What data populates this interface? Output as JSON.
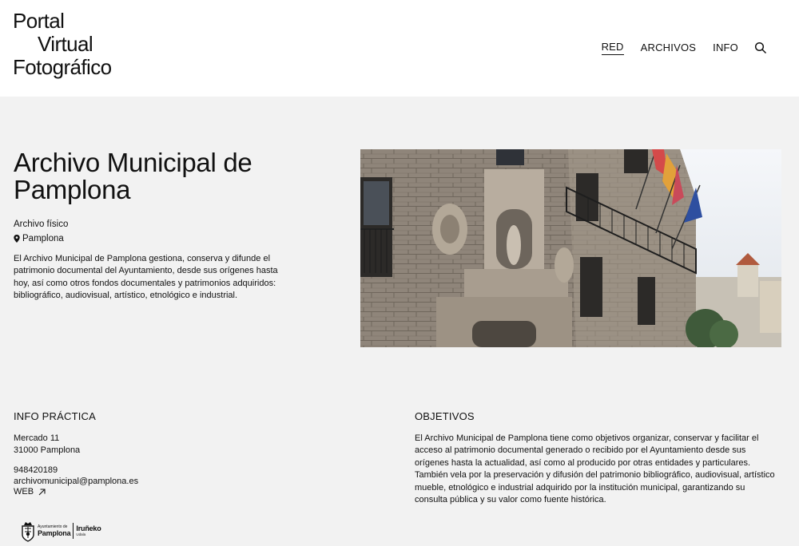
{
  "header": {
    "logo": [
      "Portal",
      "Virtual",
      "Fotográfico"
    ],
    "nav": [
      {
        "label": "RED",
        "active": true
      },
      {
        "label": "ARCHIVOS",
        "active": false
      },
      {
        "label": "INFO",
        "active": false
      }
    ]
  },
  "hero": {
    "title": "Archivo Municipal de Pamplona",
    "type": "Archivo físico",
    "location": "Pamplona",
    "description": "El Archivo Municipal de Pamplona gestiona, conserva y difunde el patrimonio documental del Ayuntamiento, desde sus orígenes hasta hoy, así como otros fondos documentales y patrimonios adquiridos: bibliográfico, audiovisual, artístico, etnológico e industrial."
  },
  "info": {
    "title": "INFO PRÁCTICA",
    "street": "Mercado 11",
    "city": "31000 Pamplona",
    "phone": "948420189",
    "email": "archivomunicipal@pamplona.es",
    "web_label": "WEB"
  },
  "objectives": {
    "title": "OBJETIVOS",
    "text": "El Archivo Municipal de Pamplona tiene como objetivos organizar, conservar y facilitar el acceso al patrimonio documental generado o recibido por el Ayuntamiento desde sus orígenes hasta la actualidad, así como al producido por otras entidades y particulares. También vela por la preservación y difusión del patrimonio bibliográfico, audiovisual, artístico mueble, etnológico e industrial adquirido por la institución municipal, garantizando su consulta pública y su valor como fuente histórica."
  },
  "footer": {
    "logo_small": "Ayuntamiento de",
    "logo_big": "Pamplona",
    "logo_big2": "Iruñeko",
    "logo_small2": "Udala"
  }
}
